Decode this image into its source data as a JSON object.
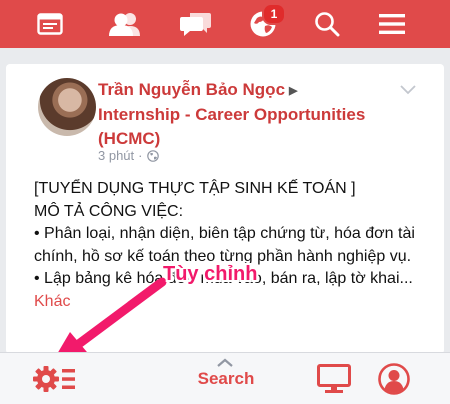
{
  "nav": {
    "items": [
      "news-feed",
      "friends",
      "messages",
      "notifications",
      "search",
      "menu"
    ],
    "notification_badge": "1"
  },
  "post": {
    "author": "Trần Nguyễn Bảo Ngọc",
    "group": "Internship - Career Opportunities (HCMC)",
    "time": "3 phút",
    "lines": [
      "[TUYỂN DỤNG THỰC TẬP SINH KẾ TOÁN ]",
      "MÔ TẢ CÔNG VIỆC:",
      "• Phân loại, nhận diện, biên tập chứng từ, hóa đơn tài chính, hồ sơ kế toán theo từng phần hành nghiệp vụ.",
      "• Lập bảng kê hóa đơn mua vào, bán ra, lập tờ khai..."
    ],
    "more_label": "Khác"
  },
  "annotation": {
    "label": "Tùy chỉnh"
  },
  "bottom": {
    "search_label": "Search"
  },
  "colors": {
    "brand": "#e04a4a",
    "annotation": "#f21a6b",
    "background": "#e9ebee"
  }
}
